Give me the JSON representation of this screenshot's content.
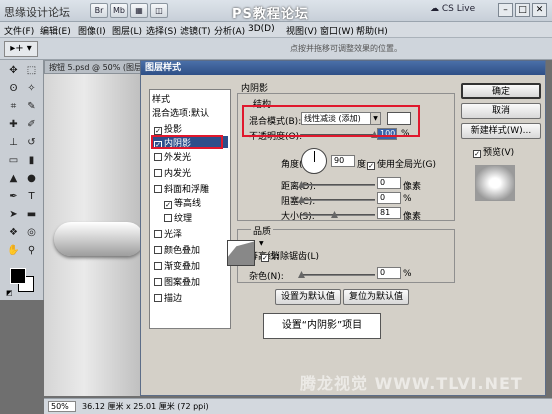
{
  "titlebar": {
    "brand": "思缘设计论坛",
    "watermark": "PS教程论坛",
    "cs_live": "CS Live"
  },
  "menubar": [
    "文件(F)",
    "编辑(E)",
    "图像(I)",
    "图层(L)",
    "选择(S)",
    "滤镜(T)",
    "分析(A)",
    "3D(D)",
    "视图(V)",
    "窗口(W)",
    "帮助(H)"
  ],
  "options": {
    "hint": "点按并拖移可调整效果的位置。"
  },
  "document": {
    "tab": "按钮 5.psd @ 50% (图层",
    "zoom": "50%",
    "dims": "36.12 厘米 x 25.01 厘米 (72 ppi)"
  },
  "dialog": {
    "title": "图层样式",
    "styles_header": "样式",
    "blend_options": "混合选项:默认",
    "items": [
      {
        "label": "投影",
        "checked": true
      },
      {
        "label": "内阴影",
        "checked": true
      },
      {
        "label": "外发光",
        "checked": false
      },
      {
        "label": "内发光",
        "checked": false
      },
      {
        "label": "斜面和浮雕",
        "checked": false
      },
      {
        "label": "等高线",
        "checked": true
      },
      {
        "label": "纹理",
        "checked": false
      },
      {
        "label": "光泽",
        "checked": false
      },
      {
        "label": "颜色叠加",
        "checked": false
      },
      {
        "label": "渐变叠加",
        "checked": false
      },
      {
        "label": "图案叠加",
        "checked": false
      },
      {
        "label": "描边",
        "checked": false
      }
    ],
    "section_title": "内阴影",
    "structure_title": "结构",
    "blend_mode_label": "混合模式(B):",
    "blend_mode_value": "线性减淡 (添加)",
    "opacity_label": "不透明度(O):",
    "opacity_value": "100",
    "angle_label": "角度(A):",
    "angle_value": "90",
    "global_light_label": "使用全局光(G)",
    "distance_label": "距离(D):",
    "distance_value": "0",
    "choke_label": "阻塞(C):",
    "choke_value": "0",
    "size_label": "大小(S):",
    "size_value": "81",
    "unit_px": "像素",
    "unit_pct": "%",
    "unit_deg": "度",
    "quality_title": "品质",
    "contour_label": "等高线:",
    "antialias_label": "消除锯齿(L)",
    "noise_label": "杂色(N):",
    "noise_value": "0",
    "set_default": "设置为默认值",
    "reset_default": "复位为默认值",
    "ok": "确定",
    "cancel": "取消",
    "new_style": "新建样式(W)...",
    "preview_label": "预览(V)",
    "callout": "设置“内阴影”项目"
  },
  "watermark_bottom": "腾龙视觉 WWW.TLVI.NET"
}
